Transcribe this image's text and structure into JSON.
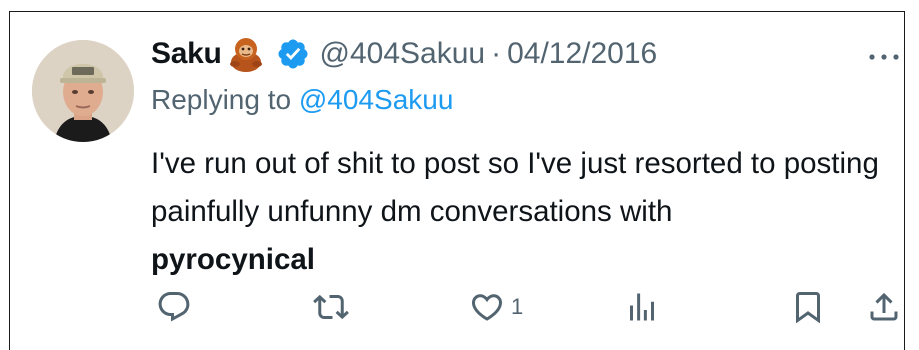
{
  "tweet": {
    "display_name": "Saku",
    "name_emoji": "orangutan-emoji",
    "verified_badge": "verified-badge-icon",
    "handle": "@404Sakuu",
    "separator": "·",
    "date": "04/12/2016",
    "replying_prefix": "Replying to",
    "replying_to": "@404Sakuu",
    "text": "I've run out of shit to post so I've just resorted to posting painfully unfunny dm conversations with",
    "mention_bold": "pyrocynical"
  },
  "actions": {
    "reply": {
      "icon": "reply-icon",
      "count": ""
    },
    "retweet": {
      "icon": "retweet-icon",
      "count": ""
    },
    "like": {
      "icon": "heart-icon",
      "count": "1"
    },
    "views": {
      "icon": "views-icon",
      "count": ""
    },
    "bookmark": {
      "icon": "bookmark-icon"
    },
    "share": {
      "icon": "share-icon"
    }
  },
  "colors": {
    "text": "#0f1419",
    "muted": "#536471",
    "link": "#1d9bf0",
    "verified": "#1d9bf0"
  }
}
